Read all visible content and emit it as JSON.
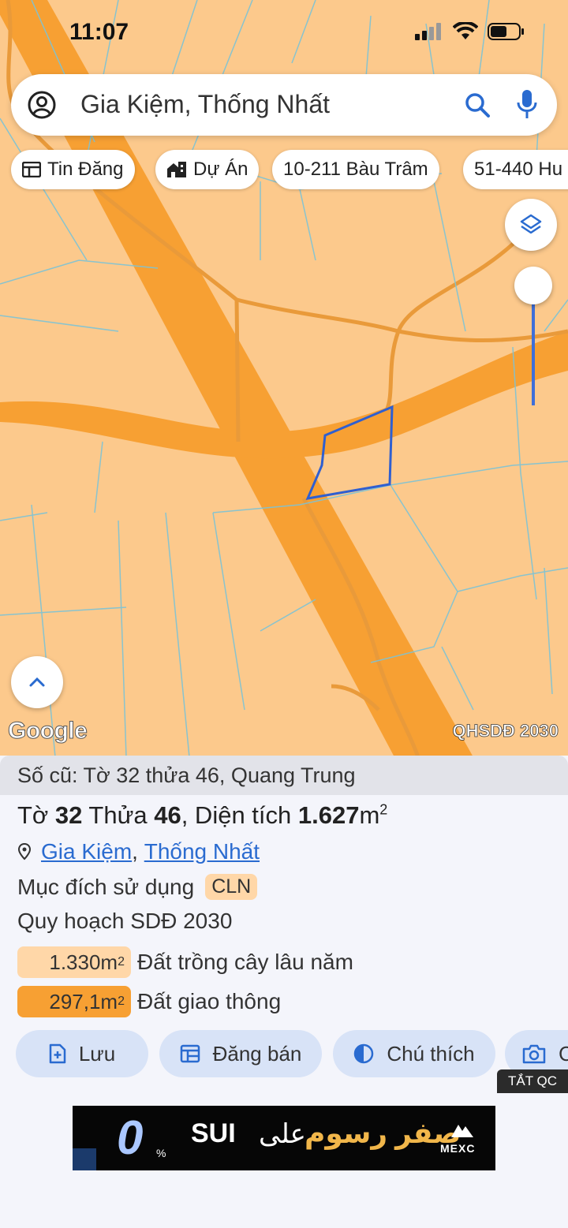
{
  "status_bar": {
    "time": "11:07"
  },
  "search": {
    "query": "Gia Kiệm, Thống Nhất"
  },
  "chips": [
    {
      "label": "Tin Đăng",
      "icon": "newspaper-icon"
    },
    {
      "label": "Dự Án",
      "icon": "building-icon"
    },
    {
      "label": "10-211 Bàu Trâm",
      "icon": ""
    },
    {
      "label": "51-440 Hu",
      "icon": ""
    }
  ],
  "map": {
    "attribution": "Google",
    "layer_label": "QHSDĐ 2030",
    "colors": {
      "land": "#fcc98c",
      "road": "#f7a033",
      "parcel_outline": "#2f5fd0"
    }
  },
  "parcel": {
    "old_ref": "Số cũ: Tờ 32 thửa 46, Quang Trung",
    "title_prefix": "Tờ ",
    "sheet": "32",
    "plot_label": " Thửa ",
    "plot": "46",
    "area_label": ", Diện tích ",
    "area": "1.627",
    "area_unit": "m",
    "area_exp": "2",
    "ward": "Gia Kiệm",
    "comma": ",",
    "district": "Thống Nhất",
    "purpose_label": "Mục đích sử dụng",
    "purpose_code": "CLN",
    "plan_label": "Quy hoạch SDĐ 2030",
    "zones": [
      {
        "value": "1.330m",
        "exp": "2",
        "label": "Đất trồng cây lâu năm",
        "color": "#ffd7a8"
      },
      {
        "value": "297,1m",
        "exp": "2",
        "label": "Đất giao thông",
        "color": "#f7a033"
      }
    ]
  },
  "actions": [
    {
      "label": "Lưu",
      "icon": "add-file-icon"
    },
    {
      "label": "Đăng bán",
      "icon": "calendar-icon"
    },
    {
      "label": "Chú thích",
      "icon": "half-circle-icon"
    },
    {
      "label": "C",
      "icon": "camera-plus-icon"
    }
  ],
  "ad": {
    "hide_label": "TẮT QC",
    "zero": "0",
    "percent": "%",
    "coin": "SUI",
    "ala": "على",
    "headline": "صفر رسوم",
    "brand": "MEXC"
  }
}
